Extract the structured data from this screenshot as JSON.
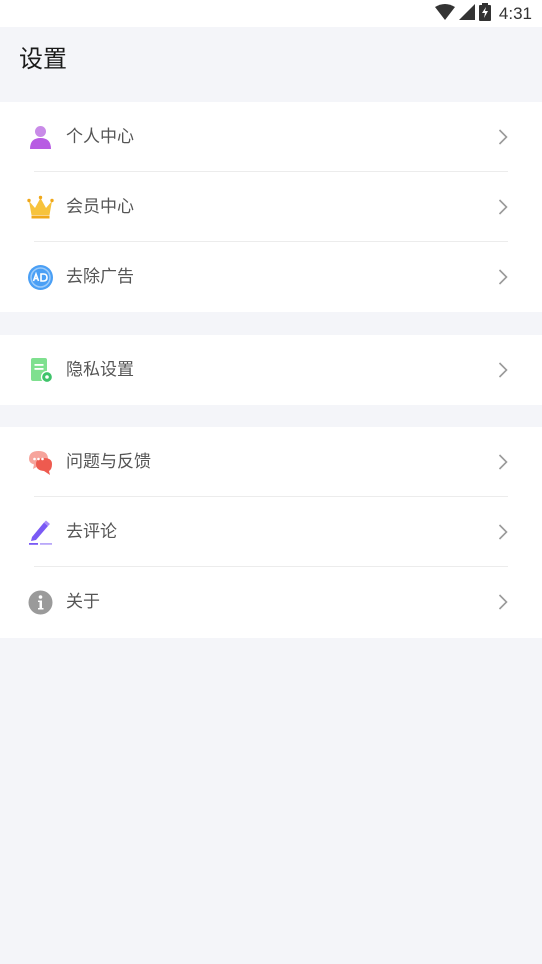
{
  "status_bar": {
    "time": "4:31",
    "icons": [
      "wifi-icon",
      "cell-signal-icon",
      "battery-charging-icon"
    ]
  },
  "header": {
    "title": "设置"
  },
  "groups": [
    {
      "items": [
        {
          "label": "个人中心",
          "icon": "person-icon",
          "icon_color": "#b85be3"
        },
        {
          "label": "会员中心",
          "icon": "crown-icon",
          "icon_color": "#f5b623"
        },
        {
          "label": "去除广告",
          "icon": "ad-remove-icon",
          "icon_color": "#4a9ff5"
        }
      ]
    },
    {
      "items": [
        {
          "label": "隐私设置",
          "icon": "privacy-document-icon",
          "icon_color": "#6edb85"
        }
      ]
    },
    {
      "items": [
        {
          "label": "问题与反馈",
          "icon": "chat-bubble-icon",
          "icon_color": "#f06a62"
        },
        {
          "label": "去评论",
          "icon": "pen-icon",
          "icon_color": "#7a5af5"
        },
        {
          "label": "关于",
          "icon": "info-icon",
          "icon_color": "#9a9a9a"
        }
      ]
    }
  ],
  "colors": {
    "background": "#f4f5f9",
    "card": "#ffffff",
    "label": "#555555",
    "chevron": "#9a9a9a"
  }
}
